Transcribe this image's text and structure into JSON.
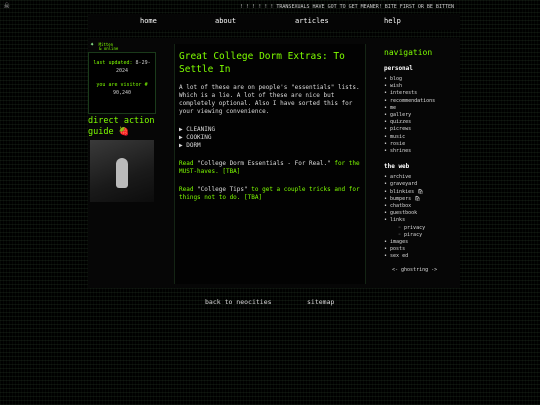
{
  "topbar": {
    "logo": "☠",
    "marquee": "! ! ! ! ! ! TRANSEXUALS HAVE GOT TO GET MEANER! BITE FIRST OR BE BITTEN"
  },
  "nav": [
    {
      "label": "home"
    },
    {
      "label": "about"
    },
    {
      "label": "articles"
    },
    {
      "label": "help"
    }
  ],
  "left": {
    "badge_line1": "Mitten",
    "badge_line2": "& online",
    "last_updated_label": "last updated:",
    "last_updated": "8-29-2024",
    "visitor_label": "you are visitor #",
    "visitor_count": "90,240",
    "direct_action": "direct action guide",
    "direct_action_icon": "🍓"
  },
  "main": {
    "title": "Great College Dorm Extras: To Settle In",
    "intro": "A lot of these are on people's \"essentials\" lists. Which is a lie. A lot of these are nice but completely optional. Also I have sorted this for your viewing convenience.",
    "sections": [
      "▶ CLEANING",
      "▶ COOKING",
      "▶ DORM"
    ],
    "read1_prefix": "Read ",
    "read1_title": "\"College Dorm Essentials - For Real.\"",
    "read1_suffix": " for the MUST-haves. [TBA]",
    "read2_prefix": "Read ",
    "read2_title": "\"College Tips\"",
    "read2_suffix": " to get a couple tricks and for things not to do. [TBA]"
  },
  "sidebar": {
    "heading": "navigation",
    "personal_heading": "personal",
    "personal": [
      "blog",
      "wish",
      "interests",
      "recommendations",
      "me",
      "gallery",
      "quizzes",
      "picrews",
      "music",
      "rosie",
      "shrines"
    ],
    "web_heading": "the web",
    "web": [
      "archive",
      "graveyard",
      "blinkies 🛍",
      "bumpers 🛍",
      "chatbox",
      "guestbook",
      "links"
    ],
    "web_sub": [
      "privacy",
      "piracy"
    ],
    "web_after": [
      "images",
      "posts",
      "sex ed"
    ],
    "webring": "<- ghostring ->"
  },
  "footer": {
    "back": "back to neocities",
    "sitemap": "sitemap"
  }
}
